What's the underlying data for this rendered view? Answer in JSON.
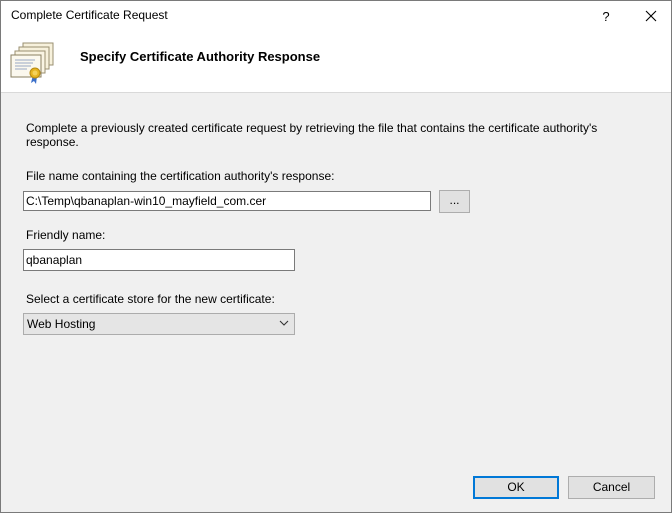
{
  "window": {
    "title": "Complete Certificate Request",
    "help_label": "?",
    "close_icon": "close-icon"
  },
  "header": {
    "title": "Specify Certificate Authority Response",
    "icon": "certificate-icon"
  },
  "description": "Complete a previously created certificate request by retrieving the file that contains the certificate authority's response.",
  "file_field": {
    "label": "File name containing the certification authority's response:",
    "value": "C:\\Temp\\qbanaplan-win10_mayfield_com.cer",
    "browse_label": "..."
  },
  "friendly_name": {
    "label": "Friendly name:",
    "value": "qbanaplan"
  },
  "store_select": {
    "label": "Select a certificate store for the new certificate:",
    "selected": "Web Hosting",
    "icon": "chevron-down-icon"
  },
  "buttons": {
    "ok_label": "OK",
    "cancel_label": "Cancel"
  },
  "colors": {
    "dialog_bg": "#f0f0f0",
    "header_bg": "#ffffff",
    "default_button_border": "#0078d7"
  }
}
